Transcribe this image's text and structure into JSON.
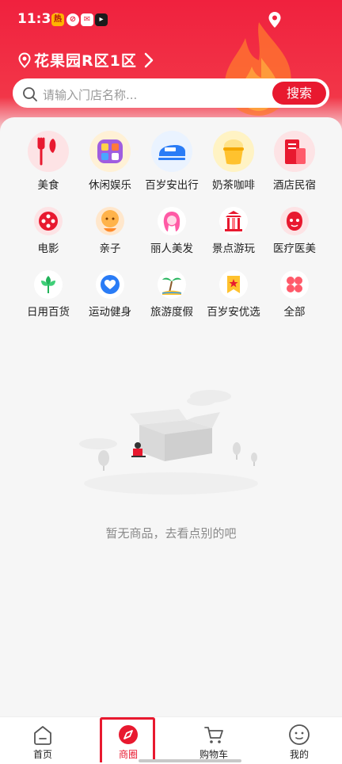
{
  "status_bar": {
    "time": "11:36",
    "icons": [
      "app-icon-1",
      "app-icon-2",
      "mail-icon",
      "app-icon-4"
    ]
  },
  "header": {
    "location": "花果园R区1区",
    "search_placeholder": "请输入门店名称...",
    "search_button": "搜索"
  },
  "categories": [
    {
      "label": "美食",
      "icon": "fork-knife-icon"
    },
    {
      "label": "休闲娱乐",
      "icon": "game-icon"
    },
    {
      "label": "百岁安出行",
      "icon": "train-icon"
    },
    {
      "label": "奶茶咖啡",
      "icon": "milk-tea-icon"
    },
    {
      "label": "酒店民宿",
      "icon": "hotel-icon"
    },
    {
      "label": "电影",
      "icon": "film-reel-icon"
    },
    {
      "label": "亲子",
      "icon": "child-icon"
    },
    {
      "label": "丽人美发",
      "icon": "beauty-icon"
    },
    {
      "label": "景点游玩",
      "icon": "landmark-icon"
    },
    {
      "label": "医疗医美",
      "icon": "medical-icon"
    },
    {
      "label": "日用百货",
      "icon": "flower-icon"
    },
    {
      "label": "运动健身",
      "icon": "heart-icon"
    },
    {
      "label": "旅游度假",
      "icon": "palm-tree-icon"
    },
    {
      "label": "百岁安优选",
      "icon": "star-bookmark-icon"
    },
    {
      "label": "全部",
      "icon": "grid-icon"
    }
  ],
  "empty_state": {
    "message": "暂无商品，去看点别的吧"
  },
  "tabbar": [
    {
      "label": "首页",
      "icon": "home-icon",
      "active": false
    },
    {
      "label": "商圈",
      "icon": "compass-icon",
      "active": true
    },
    {
      "label": "购物车",
      "icon": "cart-icon",
      "active": false
    },
    {
      "label": "我的",
      "icon": "profile-icon",
      "active": false
    }
  ],
  "colors": {
    "brand": "#e8192f",
    "header": "#f0213e",
    "background": "#f6f6f6"
  }
}
